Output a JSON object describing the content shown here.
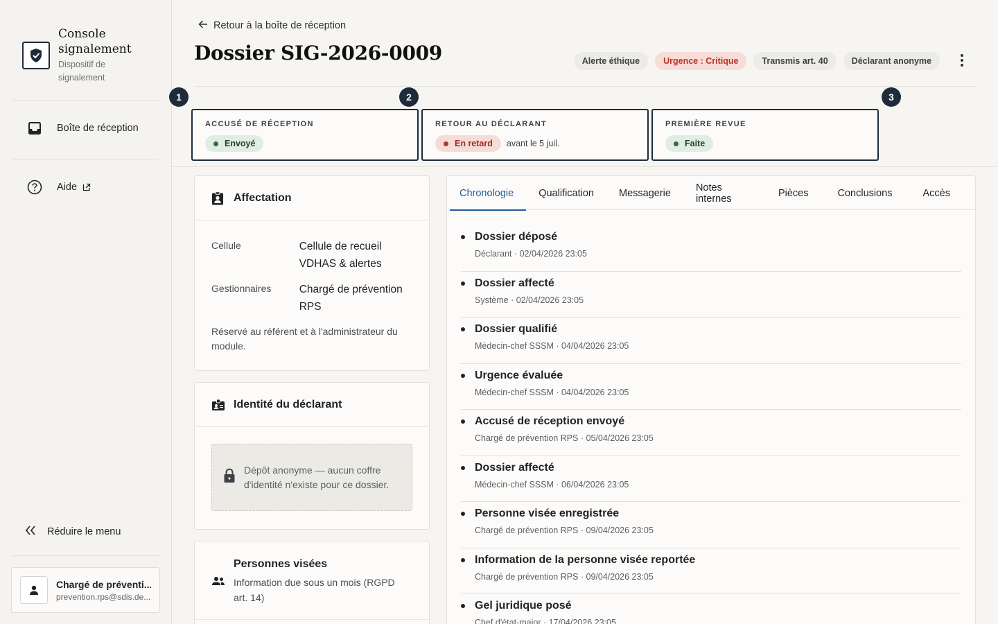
{
  "brand": {
    "title": "Console signalement",
    "subtitle": "Dispositif de signalement"
  },
  "sidebar": {
    "items": [
      {
        "label": "Boîte de réception"
      },
      {
        "label": "Aide"
      }
    ],
    "collapse_label": "Réduire le menu",
    "user": {
      "name": "Chargé de préventi...",
      "email": "prevention.rps@sdis.de..."
    }
  },
  "header": {
    "back_label": "Retour à la boîte de réception",
    "title": "Dossier SIG-2026-0009",
    "badges": [
      "Alerte éthique",
      "Urgence : Critique",
      "Transmis art. 40",
      "Déclarant anonyme"
    ]
  },
  "steps": [
    {
      "number": "1",
      "label": "ACCUSÉ DE RÉCEPTION",
      "status": "Envoyé",
      "note": ""
    },
    {
      "number": "2",
      "label": "RETOUR AU DÉCLARANT",
      "status": "En retard",
      "note": "avant le 5 juil."
    },
    {
      "number": "3",
      "label": "PREMIÈRE REVUE",
      "status": "Faite",
      "note": ""
    }
  ],
  "affectation": {
    "title": "Affectation",
    "cellule_label": "Cellule",
    "cellule_value": "Cellule de recueil VDHAS & alertes",
    "gestionnaires_label": "Gestionnaires",
    "gestionnaires_value": "Chargé de prévention RPS",
    "note": "Réservé au référent et à l'administrateur du module."
  },
  "identite": {
    "title": "Identité du déclarant",
    "locked_text": "Dépôt anonyme — aucun coffre d'identité n'existe pour ce dossier."
  },
  "personnes": {
    "title": "Personnes visées",
    "subtitle": "Information due sous un mois (RGPD art. 14)"
  },
  "tabs": [
    "Chronologie",
    "Qualification",
    "Messagerie",
    "Notes internes",
    "Pièces",
    "Conclusions",
    "Accès"
  ],
  "timeline": [
    {
      "title": "Dossier déposé",
      "meta": "Déclarant · 02/04/2026 23:05"
    },
    {
      "title": "Dossier affecté",
      "meta": "Système · 02/04/2026 23:05"
    },
    {
      "title": "Dossier qualifié",
      "meta": "Médecin-chef SSSM · 04/04/2026 23:05"
    },
    {
      "title": "Urgence évaluée",
      "meta": "Médecin-chef SSSM · 04/04/2026 23:05"
    },
    {
      "title": "Accusé de réception envoyé",
      "meta": "Chargé de prévention RPS · 05/04/2026 23:05"
    },
    {
      "title": "Dossier affecté",
      "meta": "Médecin-chef SSSM · 06/04/2026 23:05"
    },
    {
      "title": "Personne visée enregistrée",
      "meta": "Chargé de prévention RPS · 09/04/2026 23:05"
    },
    {
      "title": "Information de la personne visée reportée",
      "meta": "Chargé de prévention RPS · 09/04/2026 23:05"
    },
    {
      "title": "Gel juridique posé",
      "meta": "Chef d'état-major · 17/04/2026 23:05"
    }
  ],
  "colors": {
    "accent": "#1f5b9b",
    "navy": "#1d2b3a",
    "critical": "#b7352a",
    "success": "#2f6b44"
  }
}
